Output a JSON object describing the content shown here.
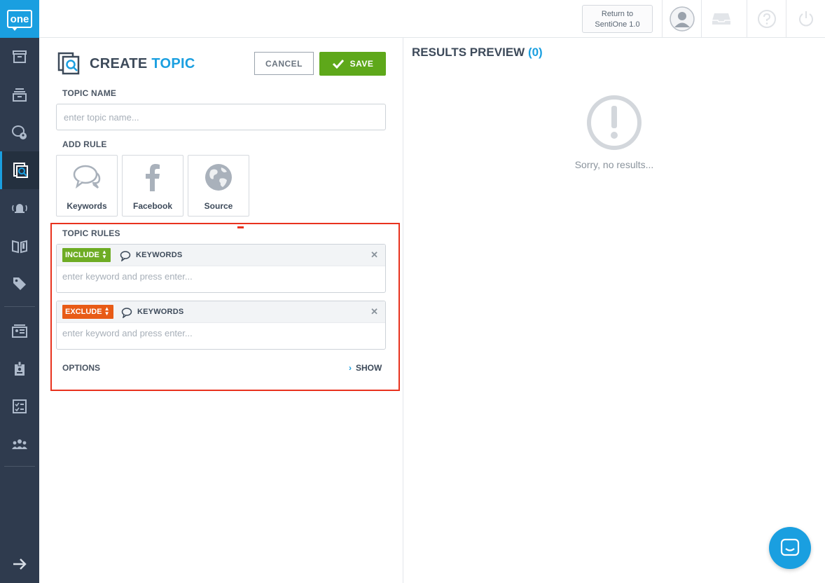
{
  "brand": {
    "logo_text": "one",
    "accent": "#1a9fe0",
    "sidebar_bg": "#2f3b4e"
  },
  "sidebar": {
    "items": [
      {
        "name": "archive-icon"
      },
      {
        "name": "stack-icon"
      },
      {
        "name": "chat-user-icon"
      },
      {
        "name": "topic-search-icon",
        "active": true
      },
      {
        "name": "bell-alert-icon"
      },
      {
        "name": "book-icon"
      },
      {
        "name": "tags-icon"
      },
      {
        "name": "id-card-icon"
      },
      {
        "name": "badge-icon"
      },
      {
        "name": "checklist-icon"
      },
      {
        "name": "team-icon"
      },
      {
        "name": "expand-arrow-icon"
      }
    ]
  },
  "topbar": {
    "return_line1": "Return to",
    "return_line2": "SentiOne 1.0",
    "icons": [
      "avatar-icon",
      "inbox-icon",
      "help-icon",
      "power-icon"
    ]
  },
  "create": {
    "title_main": "CREATE",
    "title_accent": "TOPIC",
    "cancel_label": "CANCEL",
    "save_label": "SAVE",
    "topic_name_label": "TOPIC NAME",
    "topic_name_placeholder": "enter topic name...",
    "topic_name_value": "",
    "add_rule_label": "ADD RULE",
    "rule_tiles": [
      "Keywords",
      "Facebook",
      "Source"
    ],
    "topic_rules_label": "TOPIC RULES",
    "rules": [
      {
        "mode": "INCLUDE",
        "type": "KEYWORDS",
        "placeholder": "enter keyword and press enter...",
        "color": "#6eac24"
      },
      {
        "mode": "EXCLUDE",
        "type": "KEYWORDS",
        "placeholder": "enter keyword and press enter...",
        "color": "#e85b16"
      }
    ],
    "options_label": "OPTIONS",
    "show_label": "SHOW"
  },
  "results": {
    "title": "RESULTS PREVIEW",
    "count": "(0)",
    "empty_text": "Sorry, no results..."
  }
}
